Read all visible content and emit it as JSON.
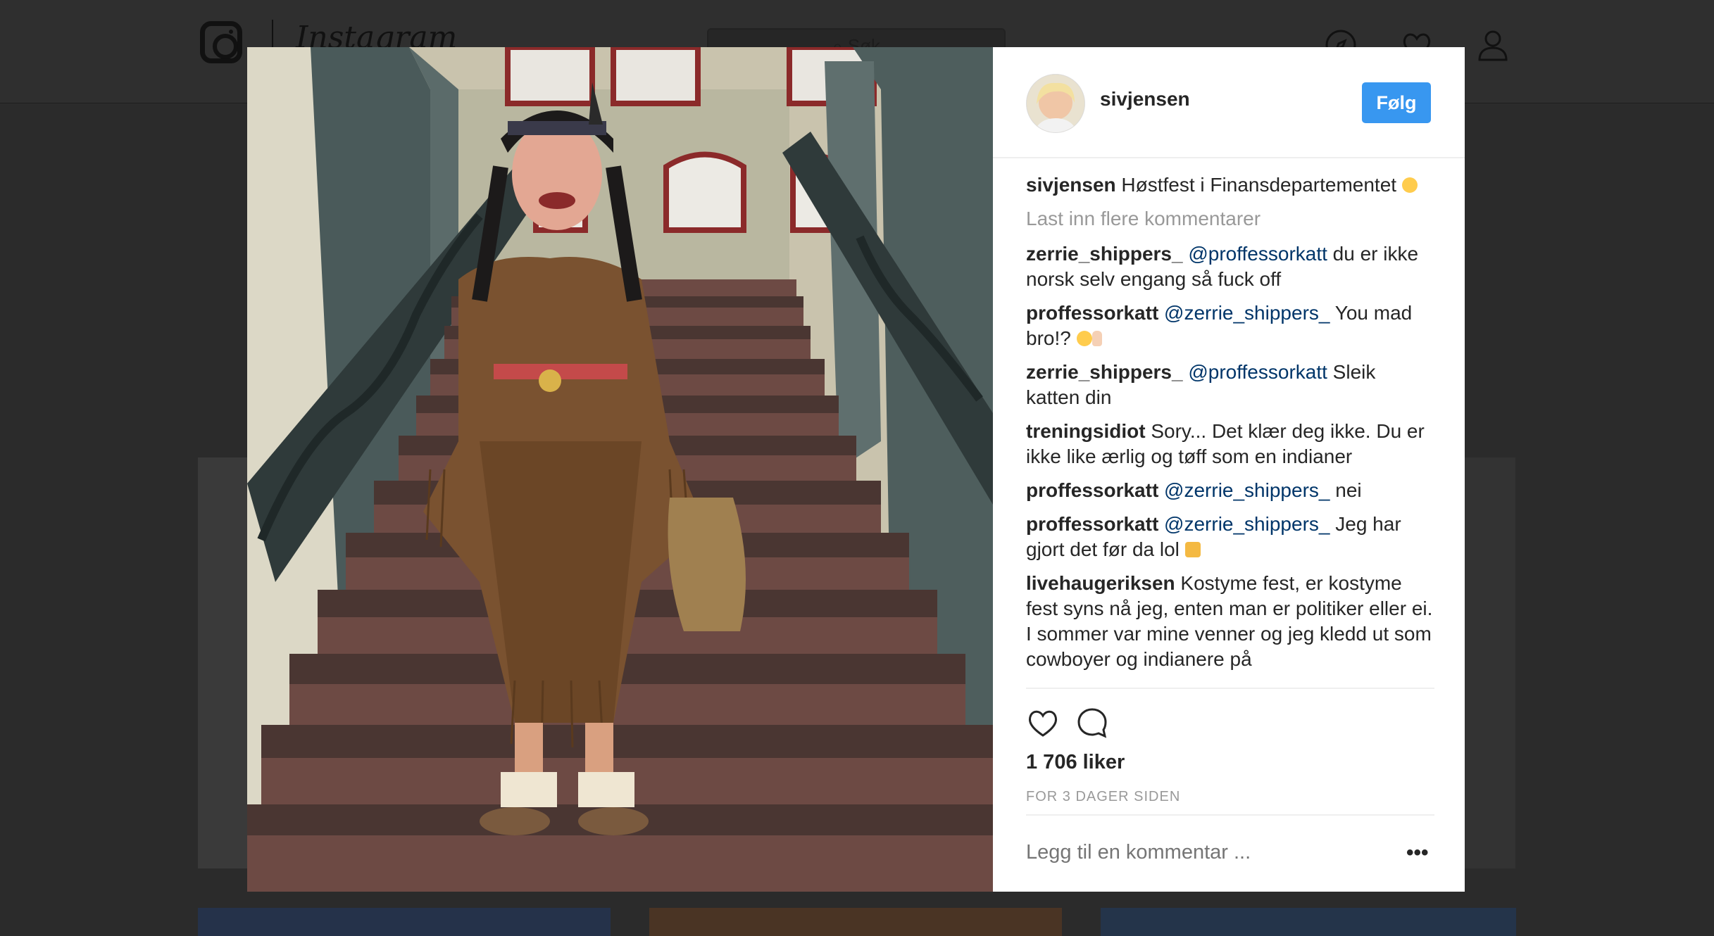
{
  "app": {
    "wordmark": "Instagram",
    "search_placeholder": "Søk"
  },
  "post": {
    "author": "sivjensen",
    "follow_label": "Følg",
    "caption_text": "Høstfest i Finansdepartementet",
    "load_more": "Last inn flere kommentarer",
    "comments": [
      {
        "user": "zerrie_shippers_",
        "mention": "@proffessorkatt",
        "text": " du er ikke norsk selv engang så fuck off"
      },
      {
        "user": "proffessorkatt",
        "mention": "@zerrie_shippers_",
        "text": " You mad bro!?"
      },
      {
        "user": "zerrie_shippers_",
        "mention": "@proffessorkatt",
        "text": " Sleik katten din"
      },
      {
        "user": "treningsidiot",
        "mention": "",
        "text": " Sory... Det klær deg ikke. Du er ikke like ærlig og tøff som en indianer"
      },
      {
        "user": "proffessorkatt",
        "mention": "@zerrie_shippers_",
        "text": " nei"
      },
      {
        "user": "proffessorkatt",
        "mention": "@zerrie_shippers_",
        "text": " Jeg har gjort det før da lol"
      },
      {
        "user": "livehaugeriksen",
        "mention": "",
        "text": " Kostyme fest, er kostyme fest syns nå jeg, enten man er politiker eller ei. I sommer var mine venner og jeg kledd ut som cowboyer og indianere på"
      }
    ],
    "likes": "1 706 liker",
    "time_ago": "FOR 3 DAGER SIDEN",
    "add_comment_placeholder": "Legg til en kommentar ...",
    "more_options": "•••"
  },
  "icons": {
    "like": "heart-icon",
    "comment": "speech-bubble-icon",
    "explore": "compass-icon",
    "activity": "heart-icon",
    "profile": "person-icon"
  },
  "colors": {
    "follow_button": "#3897f0",
    "mention": "#003569",
    "muted_text": "#999999"
  }
}
